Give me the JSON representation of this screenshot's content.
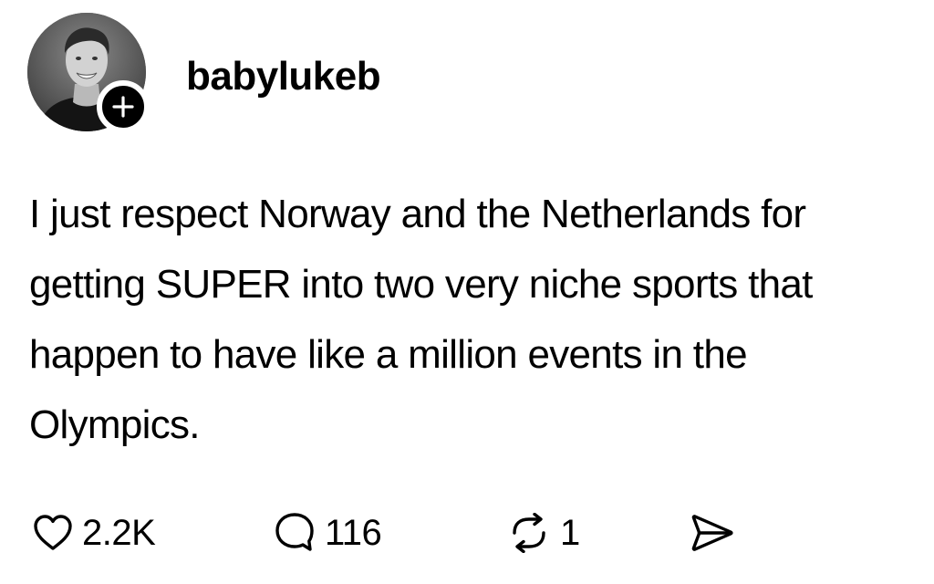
{
  "post": {
    "username": "babylukeb",
    "text": "I just respect Norway and the Netherlands for getting SUPER into two very niche sports that happen to have like a million events in the Olympics.",
    "follow_icon": "plus-icon",
    "actions": {
      "like": {
        "icon": "heart-icon",
        "count": "2.2K"
      },
      "reply": {
        "icon": "speech-bubble-icon",
        "count": "116"
      },
      "repost": {
        "icon": "repost-arrows-icon",
        "count": "1"
      },
      "share": {
        "icon": "paper-plane-icon"
      }
    }
  },
  "colors": {
    "text": "#000000",
    "background": "#ffffff",
    "badge": "#000000"
  }
}
